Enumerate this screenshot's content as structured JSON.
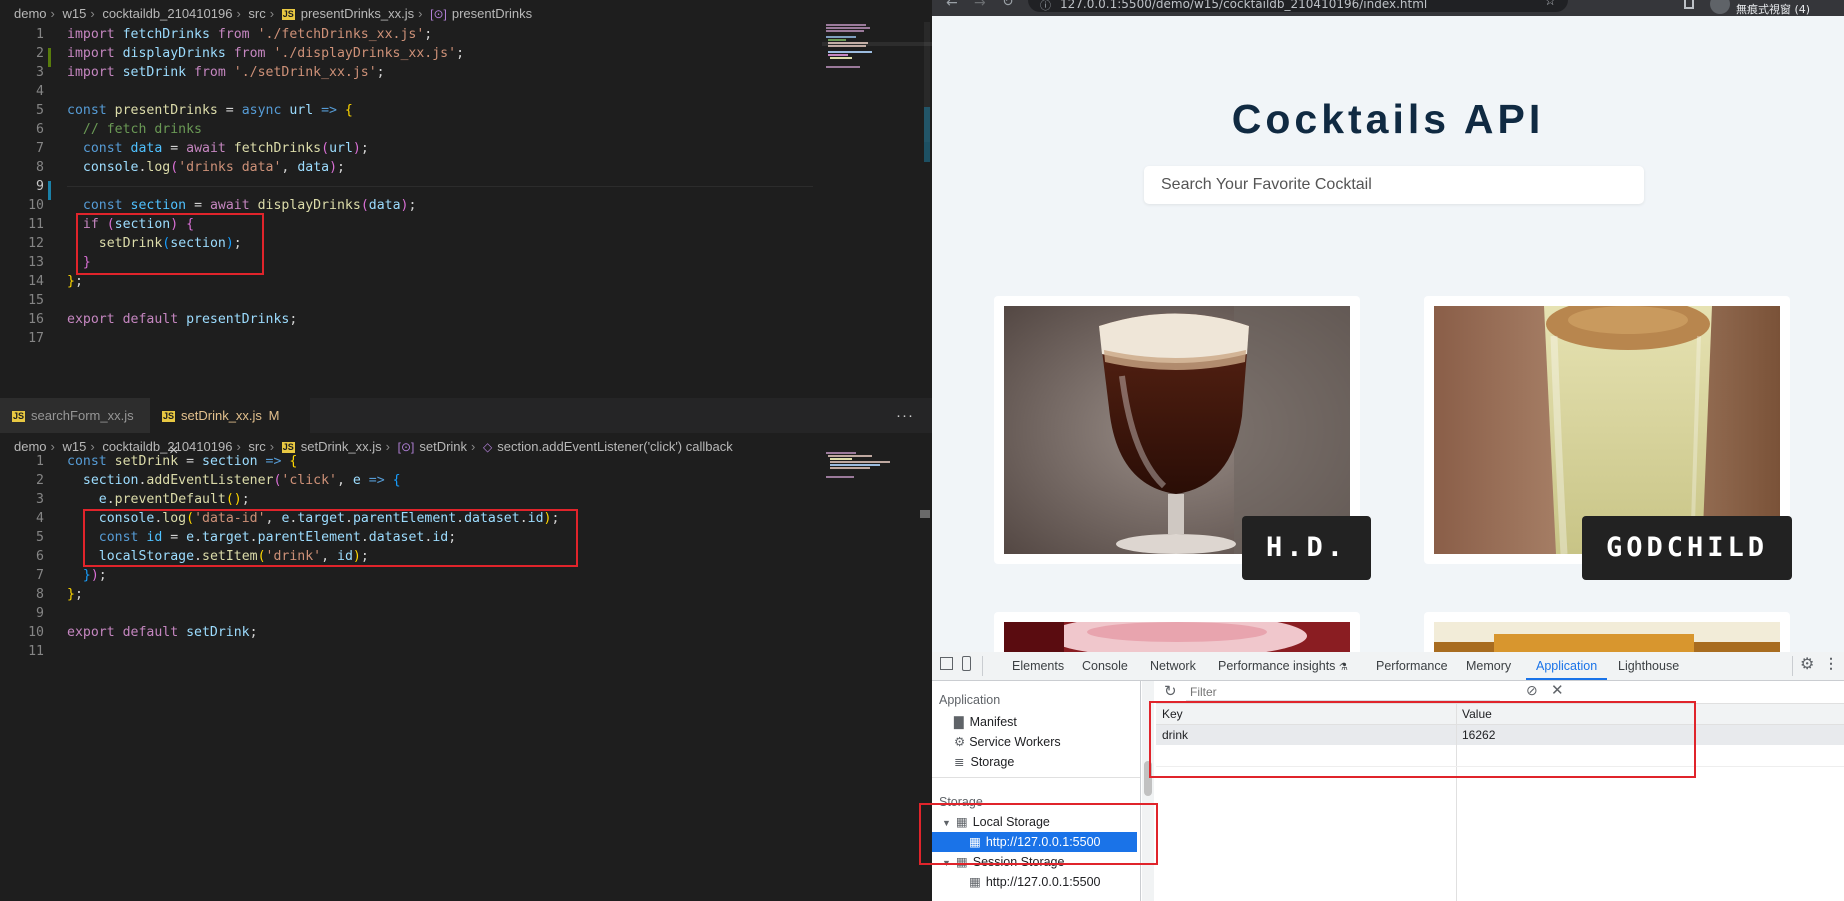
{
  "editor": {
    "top_breadcrumb": [
      "demo",
      "w15",
      "cocktaildb_210410196",
      "src",
      "presentDrinks_xx.js",
      "presentDrinks"
    ],
    "top_code": [
      {
        "n": "1",
        "tokens": [
          [
            "kw",
            "import "
          ],
          [
            "vr",
            "fetchDrinks "
          ],
          [
            "kw",
            "from "
          ],
          [
            "str",
            "'./fetchDrinks_xx.js'"
          ],
          [
            "pn",
            ";"
          ]
        ]
      },
      {
        "n": "2",
        "tokens": [
          [
            "kw",
            "import "
          ],
          [
            "vr",
            "displayDrinks "
          ],
          [
            "kw",
            "from "
          ],
          [
            "str",
            "'./displayDrinks_xx.js'"
          ],
          [
            "pn",
            ";"
          ]
        ]
      },
      {
        "n": "3",
        "tokens": [
          [
            "kw",
            "import "
          ],
          [
            "vr",
            "setDrink "
          ],
          [
            "kw",
            "from "
          ],
          [
            "str",
            "'./setDrink_xx.js'"
          ],
          [
            "pn",
            ";"
          ]
        ]
      },
      {
        "n": "4",
        "tokens": []
      },
      {
        "n": "5",
        "tokens": [
          [
            "st",
            "const "
          ],
          [
            "fn",
            "presentDrinks "
          ],
          [
            "pn",
            "= "
          ],
          [
            "st",
            "async "
          ],
          [
            "vr",
            "url "
          ],
          [
            "st",
            "=> "
          ],
          [
            "br1",
            "{"
          ]
        ]
      },
      {
        "n": "6",
        "tokens": [
          [
            "pn",
            "  "
          ],
          [
            "cm",
            "// fetch drinks"
          ]
        ]
      },
      {
        "n": "7",
        "tokens": [
          [
            "pn",
            "  "
          ],
          [
            "st",
            "const "
          ],
          [
            "cn",
            "data "
          ],
          [
            "pn",
            "= "
          ],
          [
            "kw",
            "await "
          ],
          [
            "fn",
            "fetchDrinks"
          ],
          [
            "br2",
            "("
          ],
          [
            "vr",
            "url"
          ],
          [
            "br2",
            ")"
          ],
          [
            "pn",
            ";"
          ]
        ]
      },
      {
        "n": "8",
        "tokens": [
          [
            "pn",
            "  "
          ],
          [
            "vr",
            "console"
          ],
          [
            "pn",
            "."
          ],
          [
            "fn",
            "log"
          ],
          [
            "br2",
            "("
          ],
          [
            "str",
            "'drinks data'"
          ],
          [
            "pn",
            ", "
          ],
          [
            "vr",
            "data"
          ],
          [
            "br2",
            ")"
          ],
          [
            "pn",
            ";"
          ]
        ]
      },
      {
        "n": "9",
        "tokens": []
      },
      {
        "n": "10",
        "tokens": [
          [
            "pn",
            "  "
          ],
          [
            "st",
            "const "
          ],
          [
            "cn",
            "section "
          ],
          [
            "pn",
            "= "
          ],
          [
            "kw",
            "await "
          ],
          [
            "fn",
            "displayDrinks"
          ],
          [
            "br2",
            "("
          ],
          [
            "vr",
            "data"
          ],
          [
            "br2",
            ")"
          ],
          [
            "pn",
            ";"
          ]
        ]
      },
      {
        "n": "11",
        "tokens": [
          [
            "pn",
            "  "
          ],
          [
            "kw",
            "if "
          ],
          [
            "br2",
            "("
          ],
          [
            "vr",
            "section"
          ],
          [
            "br2",
            ")"
          ],
          [
            "pn",
            " "
          ],
          [
            "br2",
            "{"
          ]
        ]
      },
      {
        "n": "12",
        "tokens": [
          [
            "pn",
            "    "
          ],
          [
            "fn",
            "setDrink"
          ],
          [
            "br3",
            "("
          ],
          [
            "vr",
            "section"
          ],
          [
            "br3",
            ")"
          ],
          [
            "pn",
            ";"
          ]
        ]
      },
      {
        "n": "13",
        "tokens": [
          [
            "pn",
            "  "
          ],
          [
            "br2",
            "}"
          ]
        ]
      },
      {
        "n": "14",
        "tokens": [
          [
            "br1",
            "}"
          ],
          [
            "pn",
            ";"
          ]
        ]
      },
      {
        "n": "15",
        "tokens": []
      },
      {
        "n": "16",
        "tokens": [
          [
            "kw",
            "export "
          ],
          [
            "kw",
            "default "
          ],
          [
            "vr",
            "presentDrinks"
          ],
          [
            "pn",
            ";"
          ]
        ]
      },
      {
        "n": "17",
        "tokens": []
      }
    ],
    "tabs": [
      {
        "label": "searchForm_xx.js",
        "active": false
      },
      {
        "label": "setDrink_xx.js",
        "active": true,
        "modified": "M",
        "close": "×"
      }
    ],
    "more_label": "···",
    "bottom_breadcrumb": [
      "demo",
      "w15",
      "cocktaildb_210410196",
      "src",
      "setDrink_xx.js",
      "setDrink",
      "section.addEventListener('click') callback"
    ],
    "bottom_code": [
      {
        "n": "1",
        "tokens": [
          [
            "st",
            "const "
          ],
          [
            "fn",
            "setDrink "
          ],
          [
            "pn",
            "= "
          ],
          [
            "vr",
            "section "
          ],
          [
            "st",
            "=> "
          ],
          [
            "br1",
            "{"
          ]
        ]
      },
      {
        "n": "2",
        "tokens": [
          [
            "pn",
            "  "
          ],
          [
            "vr",
            "section"
          ],
          [
            "pn",
            "."
          ],
          [
            "fn",
            "addEventListener"
          ],
          [
            "br2",
            "("
          ],
          [
            "str",
            "'click'"
          ],
          [
            "pn",
            ", "
          ],
          [
            "vr",
            "e "
          ],
          [
            "st",
            "=> "
          ],
          [
            "br3",
            "{"
          ]
        ]
      },
      {
        "n": "3",
        "tokens": [
          [
            "pn",
            "    "
          ],
          [
            "vr",
            "e"
          ],
          [
            "pn",
            "."
          ],
          [
            "fn",
            "preventDefault"
          ],
          [
            "br1",
            "()"
          ],
          [
            "pn",
            ";"
          ]
        ]
      },
      {
        "n": "4",
        "tokens": [
          [
            "pn",
            "    "
          ],
          [
            "vr",
            "console"
          ],
          [
            "pn",
            "."
          ],
          [
            "fn",
            "log"
          ],
          [
            "br1",
            "("
          ],
          [
            "str",
            "'data-id'"
          ],
          [
            "pn",
            ", "
          ],
          [
            "vr",
            "e"
          ],
          [
            "pn",
            "."
          ],
          [
            "vr",
            "target"
          ],
          [
            "pn",
            "."
          ],
          [
            "vr",
            "parentElement"
          ],
          [
            "pn",
            "."
          ],
          [
            "vr",
            "dataset"
          ],
          [
            "pn",
            "."
          ],
          [
            "vr",
            "id"
          ],
          [
            "br1",
            ")"
          ],
          [
            "pn",
            ";"
          ]
        ]
      },
      {
        "n": "5",
        "tokens": [
          [
            "pn",
            "    "
          ],
          [
            "st",
            "const "
          ],
          [
            "cn",
            "id "
          ],
          [
            "pn",
            "= "
          ],
          [
            "vr",
            "e"
          ],
          [
            "pn",
            "."
          ],
          [
            "vr",
            "target"
          ],
          [
            "pn",
            "."
          ],
          [
            "vr",
            "parentElement"
          ],
          [
            "pn",
            "."
          ],
          [
            "vr",
            "dataset"
          ],
          [
            "pn",
            "."
          ],
          [
            "vr",
            "id"
          ],
          [
            "pn",
            ";"
          ]
        ]
      },
      {
        "n": "6",
        "tokens": [
          [
            "pn",
            "    "
          ],
          [
            "vr",
            "localStorage"
          ],
          [
            "pn",
            "."
          ],
          [
            "fn",
            "setItem"
          ],
          [
            "br1",
            "("
          ],
          [
            "str",
            "'drink'"
          ],
          [
            "pn",
            ", "
          ],
          [
            "vr",
            "id"
          ],
          [
            "br1",
            ")"
          ],
          [
            "pn",
            ";"
          ]
        ]
      },
      {
        "n": "7",
        "tokens": [
          [
            "pn",
            "  "
          ],
          [
            "br3",
            "}"
          ],
          [
            "br2",
            ")"
          ],
          [
            "pn",
            ";"
          ]
        ]
      },
      {
        "n": "8",
        "tokens": [
          [
            "br1",
            "}"
          ],
          [
            "pn",
            ";"
          ]
        ]
      },
      {
        "n": "9",
        "tokens": []
      },
      {
        "n": "10",
        "tokens": [
          [
            "kw",
            "export "
          ],
          [
            "kw",
            "default "
          ],
          [
            "vr",
            "setDrink"
          ],
          [
            "pn",
            ";"
          ]
        ]
      },
      {
        "n": "11",
        "tokens": []
      }
    ]
  },
  "browser": {
    "url": "127.0.0.1:5500/demo/w15/cocktaildb_210410196/index.html",
    "profile": "無痕式視窗 (4)",
    "title": "Cocktails API",
    "search_placeholder": "Search Your Favorite Cocktail",
    "cards": [
      {
        "name": "H.D."
      },
      {
        "name": "GODCHILD"
      }
    ]
  },
  "devtools": {
    "tabs": [
      "Elements",
      "Console",
      "Network",
      "Performance insights",
      "Performance",
      "Memory",
      "Application",
      "Lighthouse"
    ],
    "active_tab": "Application",
    "filter_placeholder": "Filter",
    "sidebar": {
      "application_heading": "Application",
      "app_items": [
        "Manifest",
        "Service Workers",
        "Storage"
      ],
      "storage_heading": "Storage",
      "local_storage": "Local Storage",
      "local_origin": "http://127.0.0.1:5500",
      "session_storage": "Session Storage",
      "session_origin": "http://127.0.0.1:5500"
    },
    "table": {
      "headers": [
        "Key",
        "Value"
      ],
      "rows": [
        {
          "key": "drink",
          "value": "16262"
        }
      ]
    }
  },
  "colors": {
    "highlight_box": "#e0242b",
    "page_title": "#102a42",
    "devtools_accent": "#1a73e8"
  }
}
